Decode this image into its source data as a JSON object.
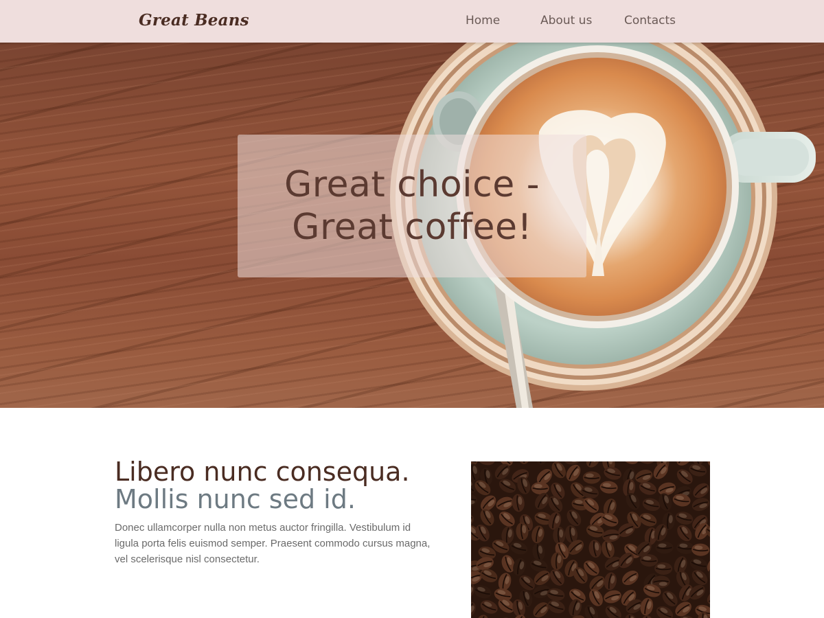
{
  "navbar": {
    "brand": "Great Beans",
    "links": [
      {
        "label": "Home"
      },
      {
        "label": "About us"
      },
      {
        "label": "Contacts"
      }
    ]
  },
  "hero": {
    "title_line1": "Great choice -",
    "title_line2": "Great coffee!"
  },
  "feature": {
    "title_line1": "Libero nunc consequa.",
    "title_line2": "Mollis nunc sed id.",
    "text": "Donec ullamcorper nulla non metus auctor fringilla. Vestibulum id ligula porta felis euismod semper. Praesent commodo cursus magna, vel scelerisque nisl consectetur."
  },
  "colors": {
    "navbar_bg": "#efdedd",
    "brand": "#4a2c22",
    "heading_dark": "#4a2c22",
    "heading_muted": "#6d7a82",
    "body_text": "#6a6a6a"
  }
}
